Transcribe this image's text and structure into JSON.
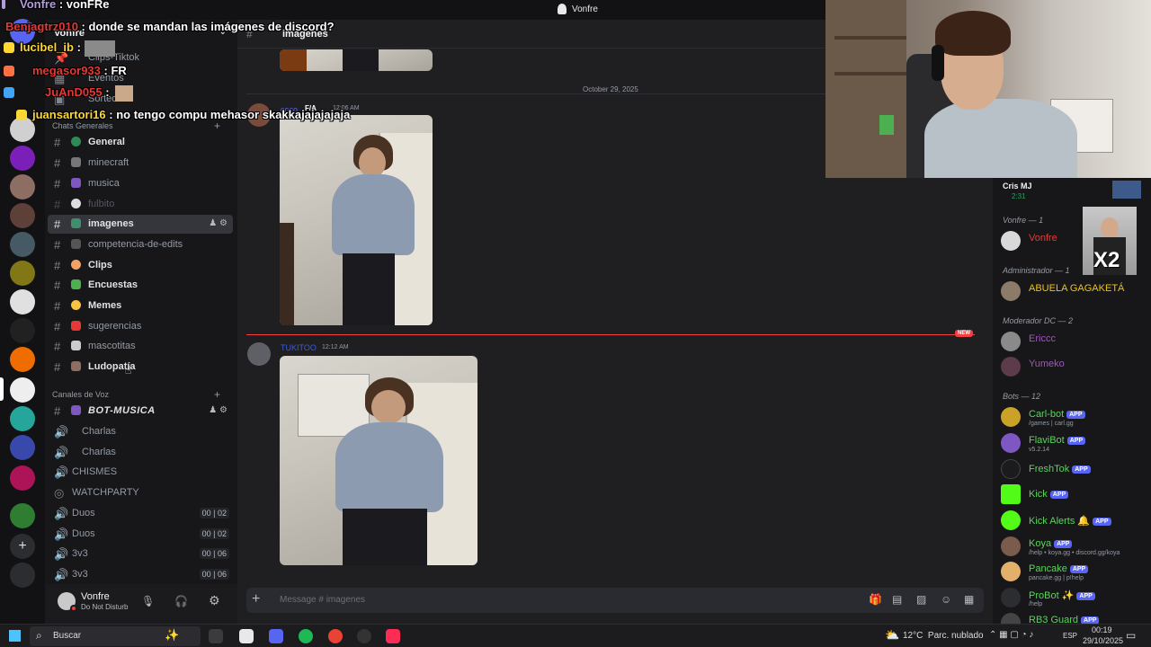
{
  "titlebar": {
    "title": "Vonfre"
  },
  "overlay_chat": [
    {
      "user": "Vonfre",
      "sep": " : ",
      "text": "vonFRe",
      "color": "#b39ddb"
    },
    {
      "user": "Benjagtrz010",
      "sep": " : ",
      "text": "donde se mandan las imágenes de discord?",
      "color": "#e53935"
    },
    {
      "user": "lucibel_ib",
      "sep": " : ",
      "text": "",
      "color": "#fdd835"
    },
    {
      "user": "megasor933",
      "sep": " : ",
      "text": "FR",
      "color": "#e53935"
    },
    {
      "user": "JuAnD055",
      "sep": " : ",
      "text": "",
      "color": "#e53935"
    },
    {
      "user": "juansartori16",
      "sep": " : ",
      "text": "no tengo compu mehasor skakkajajajajaja",
      "color": "#fdd835"
    }
  ],
  "server": {
    "name": "Vonfre"
  },
  "sidebar": {
    "top_channels": [
      "Clips-Tiktok",
      "Eventos",
      "Sorteo"
    ],
    "category_text": "Chats Generales",
    "text_channels": [
      {
        "name": "General",
        "bold": true
      },
      {
        "name": "minecraft"
      },
      {
        "name": "musica"
      },
      {
        "name": "fulbito",
        "muted": true
      },
      {
        "name": "imagenes",
        "active": true
      },
      {
        "name": "competencia-de-edits"
      },
      {
        "name": "Clips",
        "bold": true
      },
      {
        "name": "Encuestas",
        "bold": true
      },
      {
        "name": "Memes",
        "bold": true
      },
      {
        "name": "sugerencias"
      },
      {
        "name": "mascotitas"
      },
      {
        "name": "Ludopatía"
      }
    ],
    "category_voice": "Canales de Voz",
    "voice_channels": [
      {
        "name": "BOT-MUSICA",
        "hash": true,
        "italic": true
      },
      {
        "name": "Charlas"
      },
      {
        "name": "Charlas"
      },
      {
        "name": "CHISMES"
      },
      {
        "name": "WATCHPARTY"
      },
      {
        "name": "Duos",
        "count_a": "00",
        "count_b": "02"
      },
      {
        "name": "Duos",
        "count_a": "00",
        "count_b": "02"
      },
      {
        "name": "3v3",
        "count_a": "00",
        "count_b": "06"
      },
      {
        "name": "3v3",
        "count_a": "00",
        "count_b": "06"
      }
    ]
  },
  "user_panel": {
    "name": "Vonfre",
    "status": "Do Not Disturb"
  },
  "chat": {
    "channel_name": "imagenes",
    "date_divider": "October 29, 2025",
    "message1": {
      "author": "coco",
      "time": "12:06 AM",
      "badge": "F/A"
    },
    "message2": {
      "author": "TUKITOO",
      "time": "12:12 AM"
    },
    "new_label": "NEW",
    "composer_placeholder": "Message # imagenes"
  },
  "members": {
    "top_user": {
      "name": "Cris MJ",
      "sub": "2:31"
    },
    "groups": [
      {
        "label": "Vonfre — 1"
      },
      {
        "label": "Administrador — 1"
      },
      {
        "label": "Moderador DC — 2"
      },
      {
        "label": "Bots — 12"
      }
    ],
    "vonfre": [
      {
        "name": "Vonfre",
        "color": "#e53935"
      }
    ],
    "admin": [
      {
        "name": "ABUELA GAGAKETÁ",
        "color": "#f1c40f"
      }
    ],
    "mods": [
      {
        "name": "Ericcc",
        "color": "#9b59b6"
      },
      {
        "name": "Yumeko",
        "color": "#9b59b6"
      }
    ],
    "bots": [
      {
        "name": "Carl-bot",
        "sub": "/games | carl.gg",
        "app": true
      },
      {
        "name": "FlaviBot",
        "sub": "v5.2.14",
        "app": true
      },
      {
        "name": "FreshTok",
        "sub": "",
        "app": true
      },
      {
        "name": "Kick",
        "sub": "",
        "app": true
      },
      {
        "name": "Kick Alerts",
        "sub": "",
        "app": true
      },
      {
        "name": "Koya",
        "sub": "/help • koya.gg • discord.gg/koya",
        "app": true
      },
      {
        "name": "Pancake",
        "sub": "pancake.gg | p!help",
        "app": true
      },
      {
        "name": "ProBot",
        "sub": "/help",
        "app": true
      },
      {
        "name": "RB3 Guard",
        "sub": "",
        "app": true
      }
    ],
    "app_label": "APP",
    "x2_label": "X2"
  },
  "taskbar": {
    "search_placeholder": "Buscar",
    "weather": "12°C  Parc. nublado",
    "lang": "ESP",
    "time": "00:19",
    "date": "29/10/2025"
  }
}
